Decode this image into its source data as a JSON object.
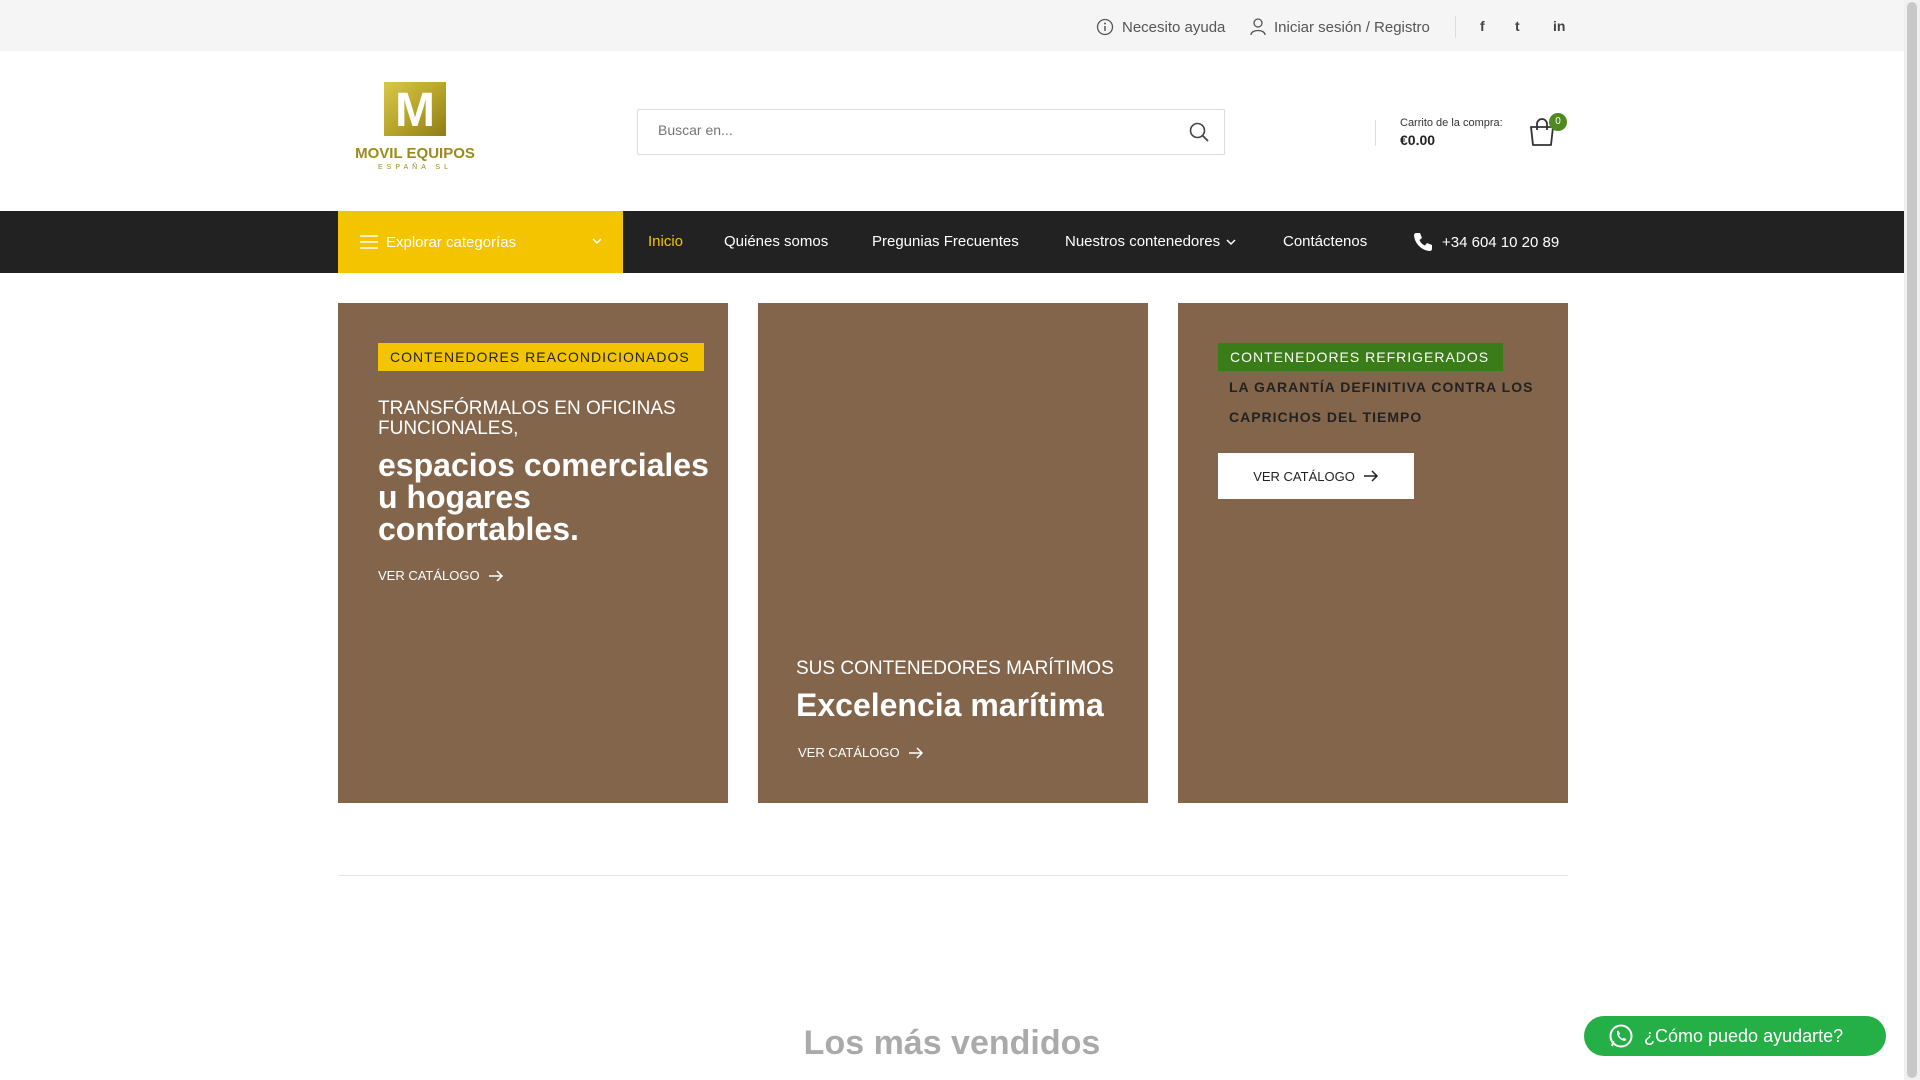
{
  "topbar": {
    "help": "Necesito ayuda",
    "login": "Iniciar sesión / Registro",
    "social": [
      "f",
      "t",
      "in"
    ]
  },
  "header": {
    "logo_text": "MOVIL EQUIPOS",
    "logo_sub": "ESPAÑA SL",
    "logo_letter": "M",
    "search_placeholder": "Buscar en...",
    "cart_label": "Carrito de la compra:",
    "cart_total": "€0.00",
    "cart_count": "0"
  },
  "nav": {
    "categories": "Explorar categorías",
    "items": [
      "Inicio",
      "Quiénes somos",
      "Pregunias Frecuentes",
      "Nuestros contenedores",
      "Contáctenos"
    ],
    "phone": "+34 604 10 20 89"
  },
  "banners": [
    {
      "tag": "CONTENEDORES REACONDICIONADOS",
      "subtitle": "TRANSFÓRMALOS EN OFICINAS FUNCIONALES,",
      "title": "espacios comerciales u hogares confortables.",
      "link": "VER CATÁLOGO"
    },
    {
      "subtitle": "SUS CONTENEDORES MARÍTIMOS",
      "title": "Excelencia marítima",
      "link": "VER CATÁLOGO"
    },
    {
      "tag": "CONTENEDORES REFRIGERADOS",
      "desc": "LA GARANTÍA DEFINITIVA CONTRA LOS CAPRICHOS DEL TIEMPO",
      "link": "VER CATÁLOGO"
    }
  ],
  "sections": {
    "bestsellers": "Los más vendidos"
  },
  "whatsapp": {
    "label": "¿Cómo puedo ayudarte?"
  },
  "colors": {
    "accent": "#f5c400",
    "nav_bg": "#222222",
    "banner_bg": "#82654a",
    "green": "#3a7c17",
    "whatsapp": "#25b047"
  }
}
